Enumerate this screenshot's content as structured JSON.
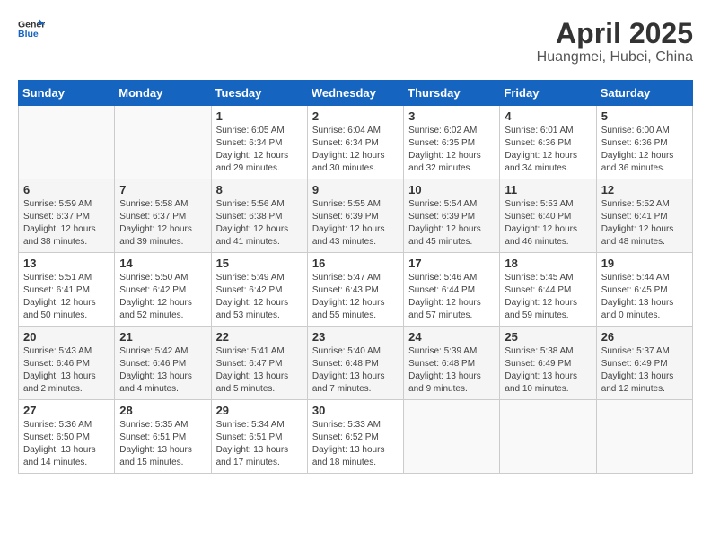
{
  "header": {
    "logo_general": "General",
    "logo_blue": "Blue",
    "title": "April 2025",
    "subtitle": "Huangmei, Hubei, China"
  },
  "calendar": {
    "days_of_week": [
      "Sunday",
      "Monday",
      "Tuesday",
      "Wednesday",
      "Thursday",
      "Friday",
      "Saturday"
    ],
    "weeks": [
      [
        {
          "day": "",
          "info": ""
        },
        {
          "day": "",
          "info": ""
        },
        {
          "day": "1",
          "info": "Sunrise: 6:05 AM\nSunset: 6:34 PM\nDaylight: 12 hours\nand 29 minutes."
        },
        {
          "day": "2",
          "info": "Sunrise: 6:04 AM\nSunset: 6:34 PM\nDaylight: 12 hours\nand 30 minutes."
        },
        {
          "day": "3",
          "info": "Sunrise: 6:02 AM\nSunset: 6:35 PM\nDaylight: 12 hours\nand 32 minutes."
        },
        {
          "day": "4",
          "info": "Sunrise: 6:01 AM\nSunset: 6:36 PM\nDaylight: 12 hours\nand 34 minutes."
        },
        {
          "day": "5",
          "info": "Sunrise: 6:00 AM\nSunset: 6:36 PM\nDaylight: 12 hours\nand 36 minutes."
        }
      ],
      [
        {
          "day": "6",
          "info": "Sunrise: 5:59 AM\nSunset: 6:37 PM\nDaylight: 12 hours\nand 38 minutes."
        },
        {
          "day": "7",
          "info": "Sunrise: 5:58 AM\nSunset: 6:37 PM\nDaylight: 12 hours\nand 39 minutes."
        },
        {
          "day": "8",
          "info": "Sunrise: 5:56 AM\nSunset: 6:38 PM\nDaylight: 12 hours\nand 41 minutes."
        },
        {
          "day": "9",
          "info": "Sunrise: 5:55 AM\nSunset: 6:39 PM\nDaylight: 12 hours\nand 43 minutes."
        },
        {
          "day": "10",
          "info": "Sunrise: 5:54 AM\nSunset: 6:39 PM\nDaylight: 12 hours\nand 45 minutes."
        },
        {
          "day": "11",
          "info": "Sunrise: 5:53 AM\nSunset: 6:40 PM\nDaylight: 12 hours\nand 46 minutes."
        },
        {
          "day": "12",
          "info": "Sunrise: 5:52 AM\nSunset: 6:41 PM\nDaylight: 12 hours\nand 48 minutes."
        }
      ],
      [
        {
          "day": "13",
          "info": "Sunrise: 5:51 AM\nSunset: 6:41 PM\nDaylight: 12 hours\nand 50 minutes."
        },
        {
          "day": "14",
          "info": "Sunrise: 5:50 AM\nSunset: 6:42 PM\nDaylight: 12 hours\nand 52 minutes."
        },
        {
          "day": "15",
          "info": "Sunrise: 5:49 AM\nSunset: 6:42 PM\nDaylight: 12 hours\nand 53 minutes."
        },
        {
          "day": "16",
          "info": "Sunrise: 5:47 AM\nSunset: 6:43 PM\nDaylight: 12 hours\nand 55 minutes."
        },
        {
          "day": "17",
          "info": "Sunrise: 5:46 AM\nSunset: 6:44 PM\nDaylight: 12 hours\nand 57 minutes."
        },
        {
          "day": "18",
          "info": "Sunrise: 5:45 AM\nSunset: 6:44 PM\nDaylight: 12 hours\nand 59 minutes."
        },
        {
          "day": "19",
          "info": "Sunrise: 5:44 AM\nSunset: 6:45 PM\nDaylight: 13 hours\nand 0 minutes."
        }
      ],
      [
        {
          "day": "20",
          "info": "Sunrise: 5:43 AM\nSunset: 6:46 PM\nDaylight: 13 hours\nand 2 minutes."
        },
        {
          "day": "21",
          "info": "Sunrise: 5:42 AM\nSunset: 6:46 PM\nDaylight: 13 hours\nand 4 minutes."
        },
        {
          "day": "22",
          "info": "Sunrise: 5:41 AM\nSunset: 6:47 PM\nDaylight: 13 hours\nand 5 minutes."
        },
        {
          "day": "23",
          "info": "Sunrise: 5:40 AM\nSunset: 6:48 PM\nDaylight: 13 hours\nand 7 minutes."
        },
        {
          "day": "24",
          "info": "Sunrise: 5:39 AM\nSunset: 6:48 PM\nDaylight: 13 hours\nand 9 minutes."
        },
        {
          "day": "25",
          "info": "Sunrise: 5:38 AM\nSunset: 6:49 PM\nDaylight: 13 hours\nand 10 minutes."
        },
        {
          "day": "26",
          "info": "Sunrise: 5:37 AM\nSunset: 6:49 PM\nDaylight: 13 hours\nand 12 minutes."
        }
      ],
      [
        {
          "day": "27",
          "info": "Sunrise: 5:36 AM\nSunset: 6:50 PM\nDaylight: 13 hours\nand 14 minutes."
        },
        {
          "day": "28",
          "info": "Sunrise: 5:35 AM\nSunset: 6:51 PM\nDaylight: 13 hours\nand 15 minutes."
        },
        {
          "day": "29",
          "info": "Sunrise: 5:34 AM\nSunset: 6:51 PM\nDaylight: 13 hours\nand 17 minutes."
        },
        {
          "day": "30",
          "info": "Sunrise: 5:33 AM\nSunset: 6:52 PM\nDaylight: 13 hours\nand 18 minutes."
        },
        {
          "day": "",
          "info": ""
        },
        {
          "day": "",
          "info": ""
        },
        {
          "day": "",
          "info": ""
        }
      ]
    ]
  }
}
